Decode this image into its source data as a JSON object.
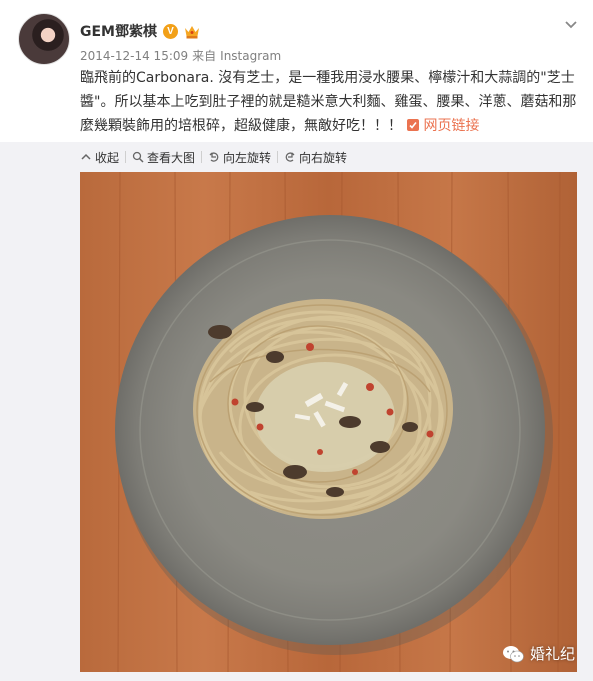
{
  "post": {
    "author": "GEM鄧紫棋",
    "verified_badge": "V",
    "timestamp": "2014-12-14 15:09",
    "source_prefix": "来自",
    "source": "Instagram",
    "text": "臨飛前的Carbonara. 沒有芝士，是一種我用浸水腰果、檸檬汁和大蒜調的\"芝士醬\"。所以基本上吃到肚子裡的就是糙米意大利麵、雞蛋、腰果、洋蔥、蘑菇和那麼幾顆裝飾用的培根碎，超級健康，無敵好吃！！！",
    "weblink_label": "网页链接",
    "accent_color": "#eb7350"
  },
  "toolbar": {
    "collapse_label": "收起",
    "view_large_label": "查看大图",
    "rotate_left_label": "向左旋转",
    "rotate_right_label": "向右旋转"
  },
  "watermark": {
    "label": "婚礼纪"
  },
  "icons": [
    "chevron-down-icon",
    "crown-icon",
    "link-icon",
    "collapse-icon",
    "zoom-icon",
    "rotate-left-icon",
    "rotate-right-icon",
    "wechat-icon"
  ]
}
